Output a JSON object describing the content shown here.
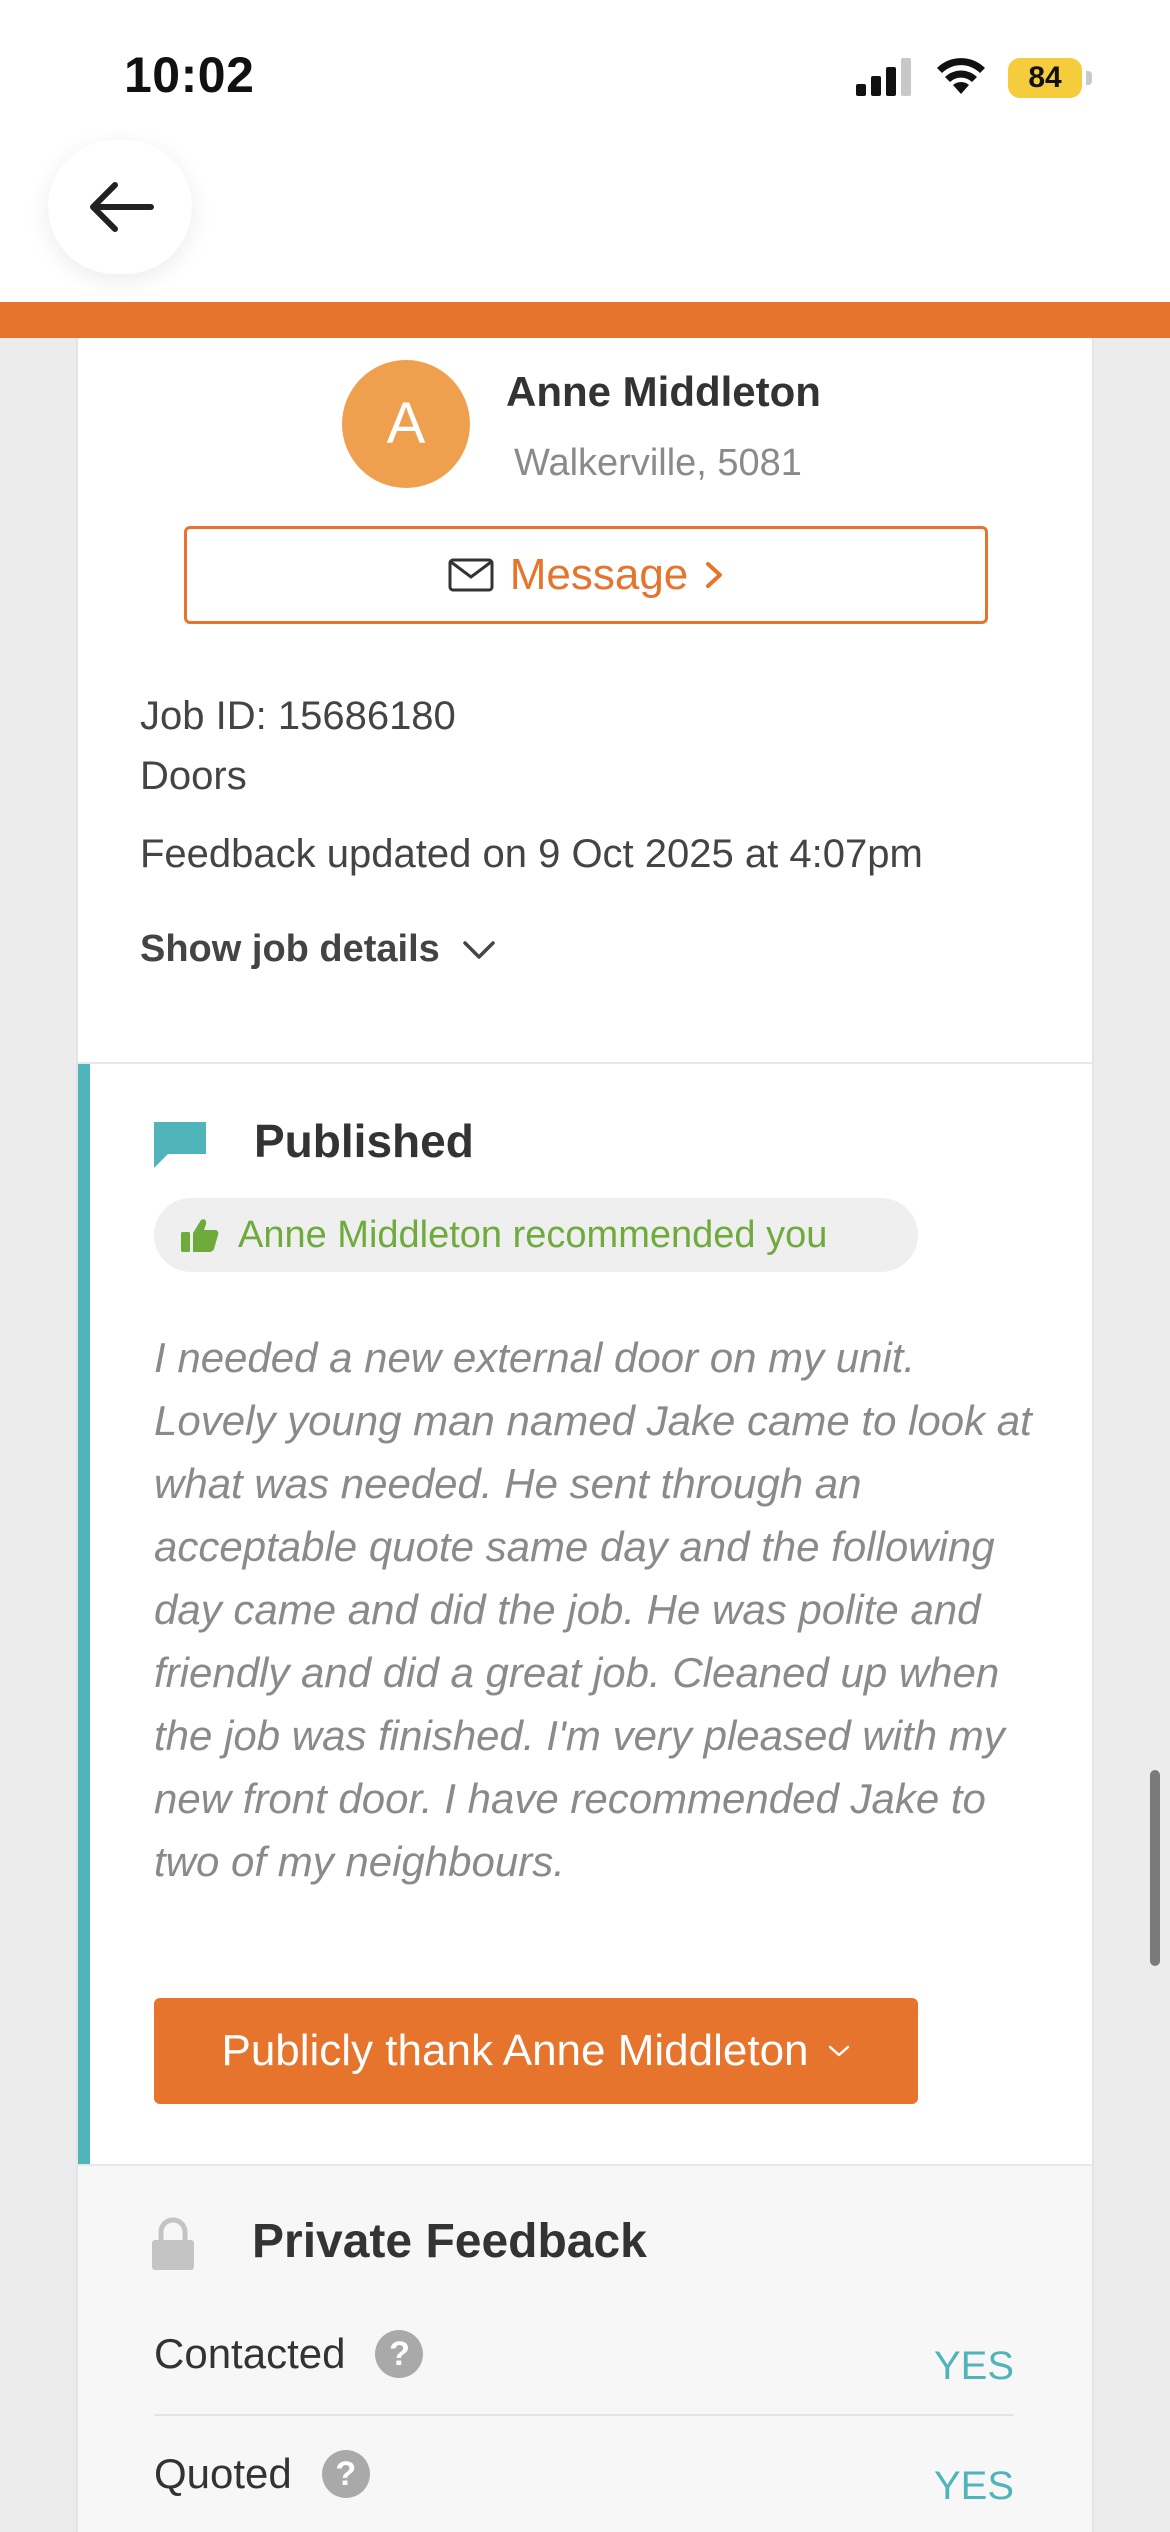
{
  "status_bar": {
    "time": "10:02",
    "battery_level": "84"
  },
  "customer": {
    "initial": "A",
    "name": "Anne Middleton",
    "location": "Walkerville, 5081",
    "message_label": "Message"
  },
  "job": {
    "id_text": "Job ID: 15686180",
    "category": "Doors",
    "feedback_updated": "Feedback updated on 9 Oct 2025 at 4:07pm",
    "show_details_label": "Show job details"
  },
  "published": {
    "title": "Published",
    "recommendation": "Anne Middleton recommended you",
    "review_text": "I needed a new external door on my unit. Lovely young man named Jake came to look at what was needed. He sent through an acceptable quote same day and the following day came and did the job. He was polite and friendly and did a great job. Cleaned up when the job was finished. I'm very pleased with my new front door. I have recommended Jake to two of my neighbours.",
    "thank_button_label": "Publicly thank Anne Middleton"
  },
  "private_feedback": {
    "title": "Private Feedback",
    "rows": [
      {
        "label": "Contacted",
        "value": "YES"
      },
      {
        "label": "Quoted",
        "value": "YES"
      }
    ]
  },
  "colors": {
    "accent": "#e6742d",
    "teal": "#4fb5ba",
    "green": "#6faa3c",
    "avatar": "#efa04f"
  },
  "icons": [
    "back-arrow-icon",
    "envelope-icon",
    "chevron-right-icon",
    "chevron-down-icon",
    "chat-bubble-icon",
    "thumbs-up-icon",
    "lock-icon",
    "help-icon"
  ]
}
